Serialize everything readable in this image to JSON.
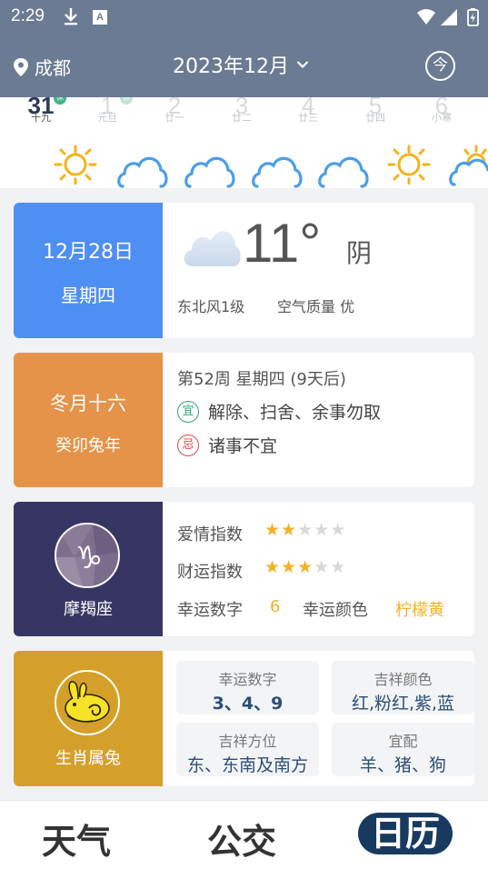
{
  "status": {
    "time": "2:29",
    "a_icon": "A"
  },
  "header": {
    "city": "成都",
    "month": "2023年12月",
    "today_label": "今"
  },
  "strip": [
    {
      "num": "31",
      "lunar": "十九",
      "badge": "休",
      "selected": true,
      "weather": "sun-icon"
    },
    {
      "num": "1",
      "lunar": "元旦",
      "badge": "休",
      "selected": false,
      "weather": "cloud-icon"
    },
    {
      "num": "2",
      "lunar": "廿一",
      "badge": "",
      "selected": false,
      "weather": "cloud-icon"
    },
    {
      "num": "3",
      "lunar": "廿二",
      "badge": "",
      "selected": false,
      "weather": "cloud-icon"
    },
    {
      "num": "4",
      "lunar": "廿三",
      "badge": "",
      "selected": false,
      "weather": "cloud-icon"
    },
    {
      "num": "5",
      "lunar": "廿四",
      "badge": "",
      "selected": false,
      "weather": "sun-icon"
    },
    {
      "num": "6",
      "lunar": "小寒",
      "badge": "",
      "selected": false,
      "weather": "sun-cloud-icon"
    }
  ],
  "weather_card": {
    "date": "12月28日",
    "weekday": "星期四",
    "temp": "11°",
    "condition": "阴",
    "wind": "东北风1级",
    "air": "空气质量 优",
    "accent": "#4e8ff3"
  },
  "almanac_card": {
    "lunar_date": "冬月十六",
    "lunar_year": "癸卯兔年",
    "week_info": "第52周  星期四 (9天后)",
    "yi_badge": "宜",
    "yi_text": "解除、扫舍、余事勿取",
    "ji_badge": "忌",
    "ji_text": "诸事不宜",
    "accent": "#e49349"
  },
  "horoscope_card": {
    "sign_name": "摩羯座",
    "sign_glyph": "♑",
    "love_label": "爱情指数",
    "love_stars": 2,
    "wealth_label": "财运指数",
    "wealth_stars": 3,
    "max_stars": 5,
    "lucky_number_label": "幸运数字",
    "lucky_number": "6",
    "lucky_color_label": "幸运颜色",
    "lucky_color": "柠檬黄",
    "accent": "#363563"
  },
  "zodiac_card": {
    "name": "生肖属兔",
    "boxes": [
      {
        "title": "幸运数字",
        "value": "3、4、9"
      },
      {
        "title": "吉祥颜色",
        "value": "红,粉红,紫,蓝"
      },
      {
        "title": "吉祥方位",
        "value": "东、东南及南方"
      },
      {
        "title": "宜配",
        "value": "羊、猪、狗"
      }
    ],
    "accent": "#d5a02a"
  },
  "tabs": [
    {
      "label": "天气",
      "active": false
    },
    {
      "label": "公交",
      "active": false
    },
    {
      "label": "日历",
      "active": true
    }
  ]
}
